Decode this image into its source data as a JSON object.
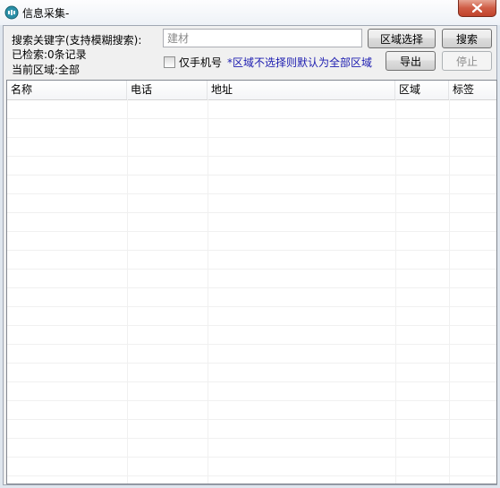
{
  "window": {
    "title": "信息采集-"
  },
  "controls": {
    "keyword_label": "搜索关键字(支持模糊搜索):",
    "found_label": "已检索:0条记录",
    "region_label": "当前区域:全部",
    "search_placeholder": "建材",
    "search_value": "",
    "mobile_only_label": "仅手机号",
    "mobile_only_checked": false,
    "region_hint": "*区域不选择则默认为全部区域",
    "region_select_button": "区域选择",
    "search_button": "搜索",
    "export_button": "导出",
    "stop_button": "停止"
  },
  "table": {
    "columns": [
      "名称",
      "电话",
      "地址",
      "区域",
      "标签"
    ],
    "rows": []
  },
  "colors": {
    "hint": "#1b1bb0",
    "close_button": "#c9533c"
  }
}
